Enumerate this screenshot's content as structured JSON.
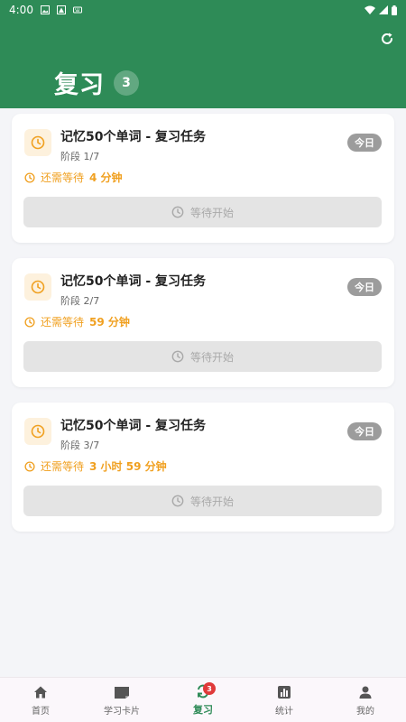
{
  "status_bar": {
    "time": "4:00"
  },
  "header": {
    "title": "复习",
    "count": "3"
  },
  "cards": [
    {
      "title": "记忆50个单词 - 复习任务",
      "stage": "阶段 1/7",
      "badge": "今日",
      "wait_prefix": "还需等待",
      "wait_detail": "4 分钟",
      "button_label": "等待开始"
    },
    {
      "title": "记忆50个单词 - 复习任务",
      "stage": "阶段 2/7",
      "badge": "今日",
      "wait_prefix": "还需等待",
      "wait_detail": "59 分钟",
      "button_label": "等待开始"
    },
    {
      "title": "记忆50个单词 - 复习任务",
      "stage": "阶段 3/7",
      "badge": "今日",
      "wait_prefix": "还需等待",
      "wait_detail": "3 小时 59 分钟",
      "button_label": "等待开始"
    }
  ],
  "bottom_nav": {
    "items": [
      {
        "label": "首页",
        "icon": "home-icon"
      },
      {
        "label": "学习卡片",
        "icon": "card-icon"
      },
      {
        "label": "复习",
        "icon": "review-icon",
        "badge": "3"
      },
      {
        "label": "统计",
        "icon": "stats-icon"
      },
      {
        "label": "我的",
        "icon": "person-icon"
      }
    ]
  },
  "colors": {
    "header": "#2e8b57",
    "accent_orange": "#f0a020",
    "badge_gray": "#9c9c9c",
    "nav_badge_red": "#e03a3a"
  }
}
